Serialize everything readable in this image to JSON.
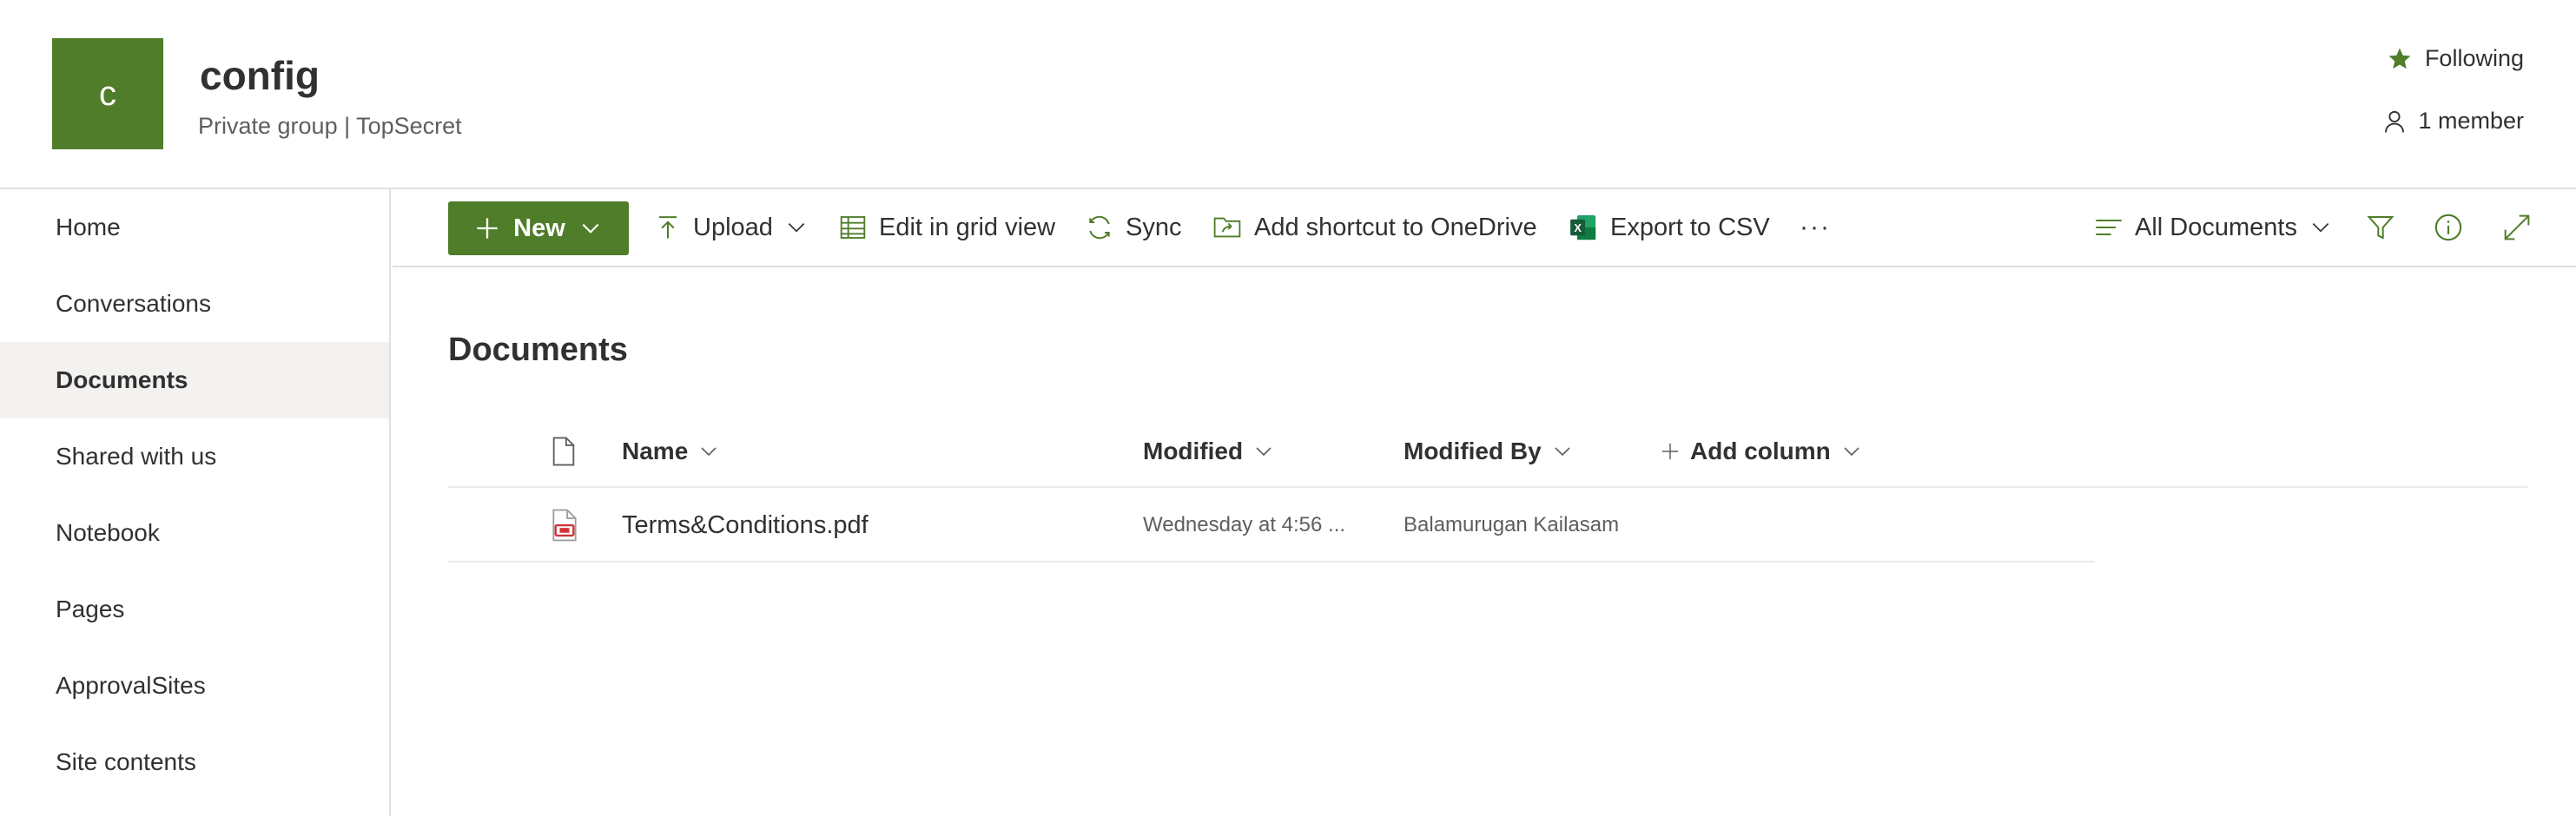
{
  "header": {
    "logo_letter": "c",
    "title": "config",
    "subtitle": "Private group | TopSecret",
    "following_label": "Following",
    "members_label": "1 member"
  },
  "nav": {
    "items": [
      {
        "label": "Home"
      },
      {
        "label": "Conversations"
      },
      {
        "label": "Documents",
        "active": true
      },
      {
        "label": "Shared with us"
      },
      {
        "label": "Notebook"
      },
      {
        "label": "Pages"
      },
      {
        "label": "ApprovalSites"
      },
      {
        "label": "Site contents"
      }
    ]
  },
  "commands": {
    "new_label": "New",
    "upload_label": "Upload",
    "grid_label": "Edit in grid view",
    "sync_label": "Sync",
    "shortcut_label": "Add shortcut to OneDrive",
    "export_label": "Export to CSV",
    "more_label": "···",
    "view_label": "All Documents"
  },
  "library": {
    "title": "Documents",
    "columns": {
      "name": "Name",
      "modified": "Modified",
      "modified_by": "Modified By",
      "add_column": "Add column"
    },
    "rows": [
      {
        "name": "Terms&Conditions.pdf",
        "modified": "Wednesday at 4:56 ...",
        "modified_by": "Balamurugan Kailasam",
        "file_type_icon": "pdf-file-icon"
      }
    ]
  },
  "colors": {
    "brand_green": "#4f7d2a",
    "text_primary": "#323130",
    "text_secondary": "#605e5c",
    "divider": "#e1dfdd",
    "nav_active_bg": "#f3f2f1",
    "pdf_red": "#d13438"
  }
}
